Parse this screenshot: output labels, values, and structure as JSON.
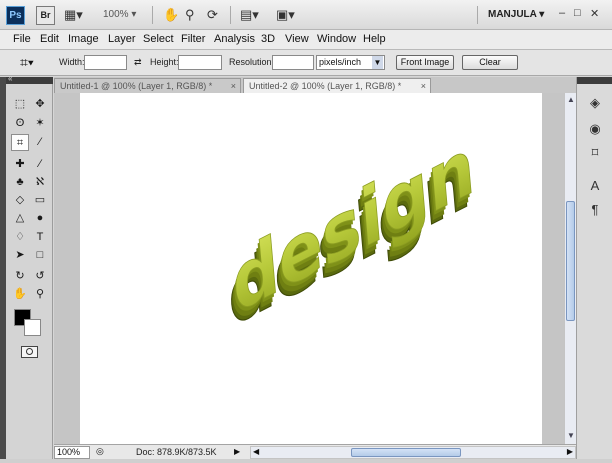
{
  "appbar": {
    "ps_logo": "Ps",
    "br_logo": "Br",
    "zoom": "100%",
    "workspace": "MANJULA",
    "icons": [
      "screen-mode-icon",
      "hand-icon",
      "zoom-icon",
      "rotate-view-icon",
      "arrange-documents-icon",
      "screen-view-icon"
    ]
  },
  "menu": [
    "File",
    "Edit",
    "Image",
    "Layer",
    "Select",
    "Filter",
    "Analysis",
    "3D",
    "View",
    "Window",
    "Help"
  ],
  "options": {
    "width_label": "Width:",
    "height_label": "Height:",
    "resolution_label": "Resolution:",
    "resolution_unit": "pixels/inch",
    "front_image_button": "Front Image",
    "clear_button": "Clear"
  },
  "tabs": [
    {
      "label": "Untitled-1 @ 100% (Layer 1, RGB/8) *",
      "close": "×"
    },
    {
      "label": "Untitled-2 @ 100% (Layer 1, RGB/8) *",
      "close": "×"
    }
  ],
  "canvas": {
    "text": "design",
    "colors": {
      "face": "#b7c93a",
      "side": "#6f7f12",
      "shadow": "#48540a"
    }
  },
  "status": {
    "zoom": "100%",
    "doc": "Doc: 878.9K/873.5K"
  },
  "panels_collapse": "«"
}
